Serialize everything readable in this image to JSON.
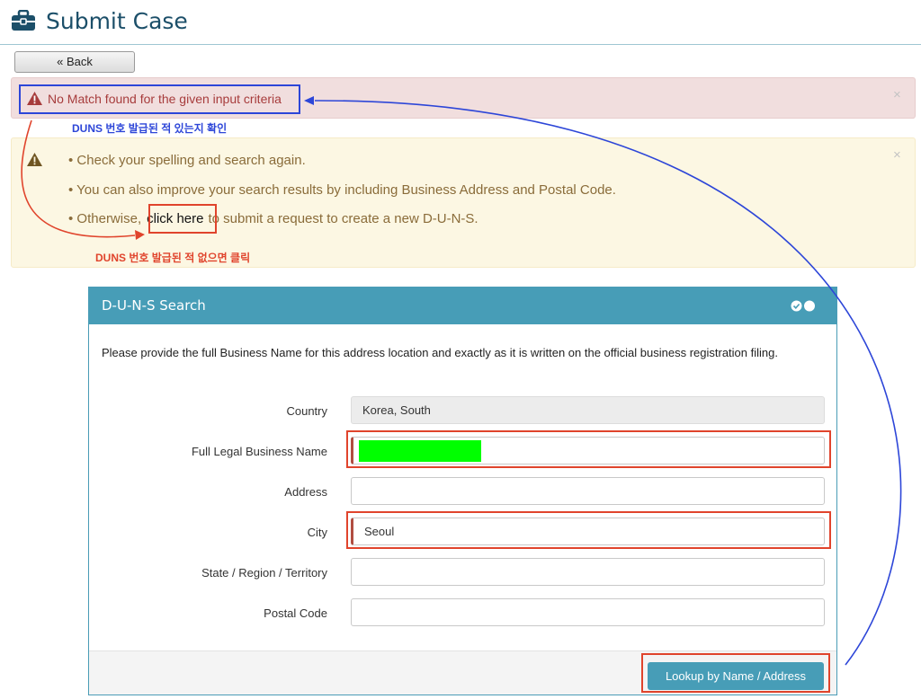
{
  "header": {
    "title": "Submit Case",
    "icon": "briefcase-icon"
  },
  "back_button": "« Back",
  "error_alert": {
    "message": "No Match found for the given input criteria",
    "close": "×"
  },
  "warning_alert": {
    "items": [
      "Check your spelling and search again.",
      "You can also improve your search results by including Business Address and Postal Code."
    ],
    "otherwise_prefix": "Otherwise,",
    "link_text": "click here",
    "otherwise_suffix": "to submit a request to create a new D-U-N-S.",
    "close": "×"
  },
  "annotations": {
    "blue_note": "DUNS 번호 발급된 적 있는지 확인",
    "red_note": "DUNS 번호 발급된 적 없으면 클릭",
    "blue_color": "#2d46d8",
    "red_color": "#e0442c"
  },
  "panel": {
    "title": "D-U-N-S Search",
    "description": "Please provide the full Business Name for this address location and exactly as it is written on the official business registration filing.",
    "fields": {
      "country": {
        "label": "Country",
        "value": "Korea, South"
      },
      "business_name": {
        "label": "Full Legal Business Name",
        "value": ""
      },
      "address": {
        "label": "Address",
        "value": ""
      },
      "city": {
        "label": "City",
        "value": "Seoul"
      },
      "state": {
        "label": "State / Region / Territory",
        "value": ""
      },
      "postal": {
        "label": "Postal Code",
        "value": ""
      }
    },
    "lookup_button": "Lookup by Name / Address"
  },
  "colors": {
    "accent": "#479db7",
    "title": "#1c4f69",
    "error_bg": "#f1dede",
    "warning_bg": "#fcf7e3",
    "redaction": "#00ff00"
  }
}
